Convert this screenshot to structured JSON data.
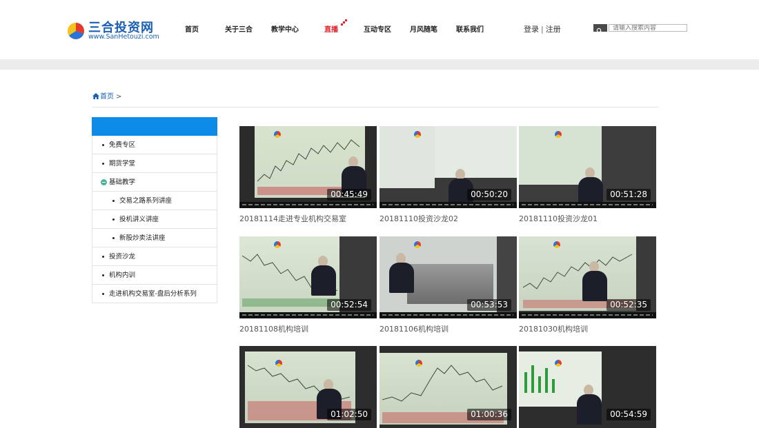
{
  "brand": {
    "name": "三合投资网",
    "url": "www.SanHetouzi.com"
  },
  "nav": [
    {
      "label": "首页",
      "live": false
    },
    {
      "label": "关于三合",
      "live": false
    },
    {
      "label": "教学中心",
      "live": false
    },
    {
      "label": "直播",
      "live": true
    },
    {
      "label": "互动专区",
      "live": false
    },
    {
      "label": "月风随笔",
      "live": false
    },
    {
      "label": "联系我们",
      "live": false
    }
  ],
  "auth": {
    "login": "登录",
    "separator": "|",
    "register": "注册"
  },
  "search": {
    "placeholder": "请输入搜索内容"
  },
  "breadcrumb": {
    "home": "首页",
    "arrow": ">"
  },
  "sidebar": {
    "items": [
      {
        "label": "免费专区",
        "type": "item"
      },
      {
        "label": "期货学堂",
        "type": "item"
      },
      {
        "label": "基础教学",
        "type": "expanded"
      },
      {
        "label": "交易之路系列讲座",
        "type": "sub"
      },
      {
        "label": "投机讲义讲座",
        "type": "sub"
      },
      {
        "label": "新股炒卖法讲座",
        "type": "sub"
      },
      {
        "label": "投资沙龙",
        "type": "item"
      },
      {
        "label": "机构内训",
        "type": "item"
      },
      {
        "label": "走进机构交易室-盘后分析系列",
        "type": "item"
      }
    ]
  },
  "videos": [
    {
      "title": "20181114走进专业机构交易室",
      "duration": "00:45:49"
    },
    {
      "title": "20181110投资沙龙02",
      "duration": "00:50:20"
    },
    {
      "title": "20181110投资沙龙01",
      "duration": "00:51:28"
    },
    {
      "title": "20181108机构培训",
      "duration": "00:52:54"
    },
    {
      "title": "20181106机构培训",
      "duration": "00:53:53"
    },
    {
      "title": "20181030机构培训",
      "duration": "00:52:35"
    },
    {
      "title": "",
      "duration": "01:02:50"
    },
    {
      "title": "",
      "duration": "01:00:36"
    },
    {
      "title": "",
      "duration": "00:54:59"
    }
  ],
  "colors": {
    "brand": "#1a5fb4",
    "live": "#e0242b",
    "sidebar_header": "#0c8be9"
  }
}
